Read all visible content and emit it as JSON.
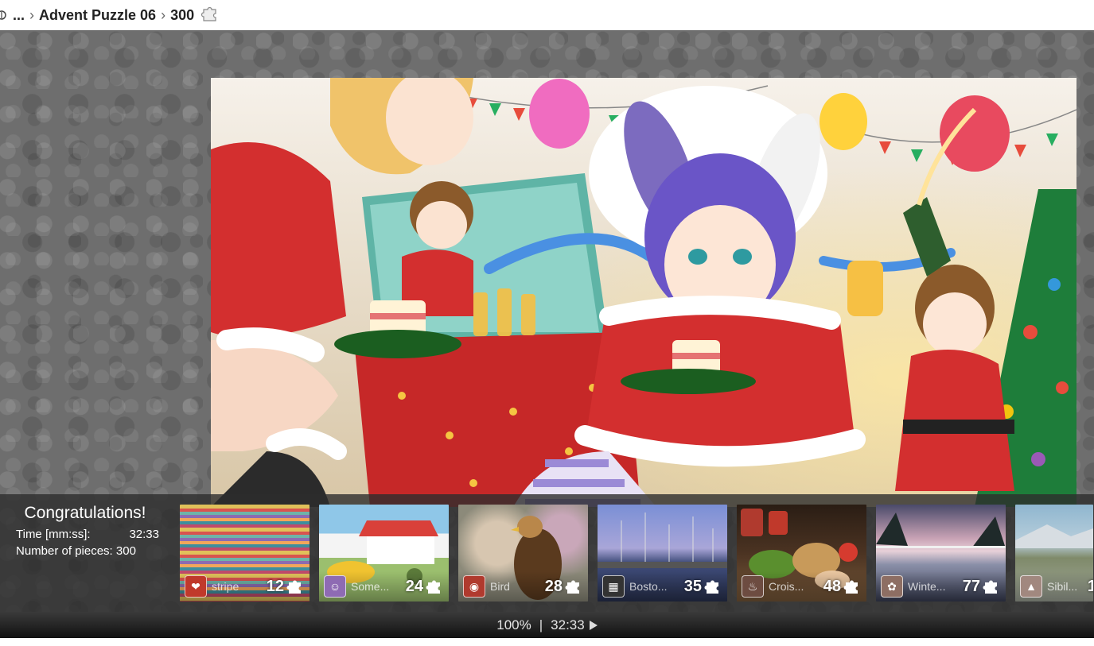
{
  "breadcrumb": {
    "ellipsis": "...",
    "title": "Advent Puzzle 06",
    "pieces": "300"
  },
  "congrats": {
    "title": "Congratulations!",
    "time_label": "Time [mm:ss]:",
    "time_value": "32:33",
    "pieces_label": "Number of pieces: 300"
  },
  "gallery": [
    {
      "name": "stripe",
      "count": "12",
      "category_icon": "heart-icon",
      "accent": "#c0392b"
    },
    {
      "name": "Some...",
      "count": "24",
      "category_icon": "cartoon-icon",
      "accent": "#8e6bb3"
    },
    {
      "name": "Bird",
      "count": "28",
      "category_icon": "bird-icon",
      "accent": "#b03a2e"
    },
    {
      "name": "Bosto...",
      "count": "35",
      "category_icon": "city-icon",
      "accent": "#333333"
    },
    {
      "name": "Crois...",
      "count": "48",
      "category_icon": "food-icon",
      "accent": "#6d4c41"
    },
    {
      "name": "Winte...",
      "count": "77",
      "category_icon": "nature-icon",
      "accent": "#8d6e63"
    },
    {
      "name": "Sibil...",
      "count": "1",
      "category_icon": "landscape-icon",
      "accent": "#a1887f"
    }
  ],
  "status": {
    "zoom": "100%",
    "separator": "|",
    "timer": "32:33"
  },
  "icons": {
    "breadcrumb_home": "home-icon",
    "puzzle": "puzzle-piece-icon",
    "play": "play-icon"
  }
}
